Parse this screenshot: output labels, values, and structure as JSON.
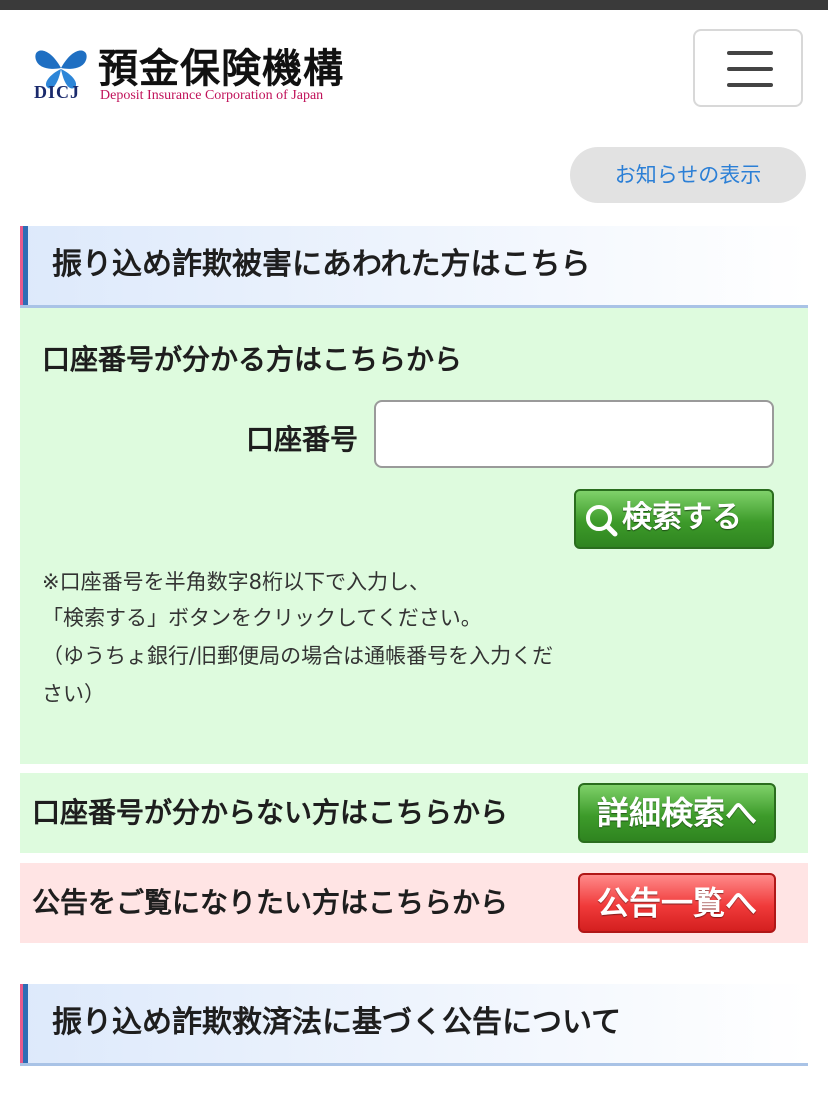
{
  "header": {
    "logo_jp": "預金保険機構",
    "logo_en": "Deposit Insurance Corporation of Japan",
    "logo_abbr": "DICJ",
    "menu_icon": "hamburger-icon"
  },
  "notice_button": "お知らせの表示",
  "section1": {
    "title": "振り込め詐欺被害にあわれた方はこちら"
  },
  "search_panel": {
    "title": "口座番号が分かる方はこちらから",
    "account_label": "口座番号",
    "account_value": "",
    "account_placeholder": "",
    "search_button": "検索する",
    "search_icon": "magnifier-icon",
    "notes": [
      "※口座番号を半角数字8桁以下で入力し、",
      "「検索する」ボタンをクリックしてください。",
      "（ゆうちょ銀行/旧郵便局の場合は通帳番号を入力くだ",
      "さい）"
    ]
  },
  "unknown_row": {
    "text": "口座番号が分からない方はこちらから",
    "button": "詳細検索へ"
  },
  "notice_row": {
    "text": "公告をご覧になりたい方はこちらから",
    "button": "公告一覧へ"
  },
  "section2": {
    "title": "振り込め詐欺救済法に基づく公告について"
  },
  "colors": {
    "accent_blue": "#2b7fd6",
    "green_panel": "#defbde",
    "pink_panel": "#ffe4e4",
    "green_button": "#3d9b2a",
    "red_button": "#f03a3a"
  }
}
